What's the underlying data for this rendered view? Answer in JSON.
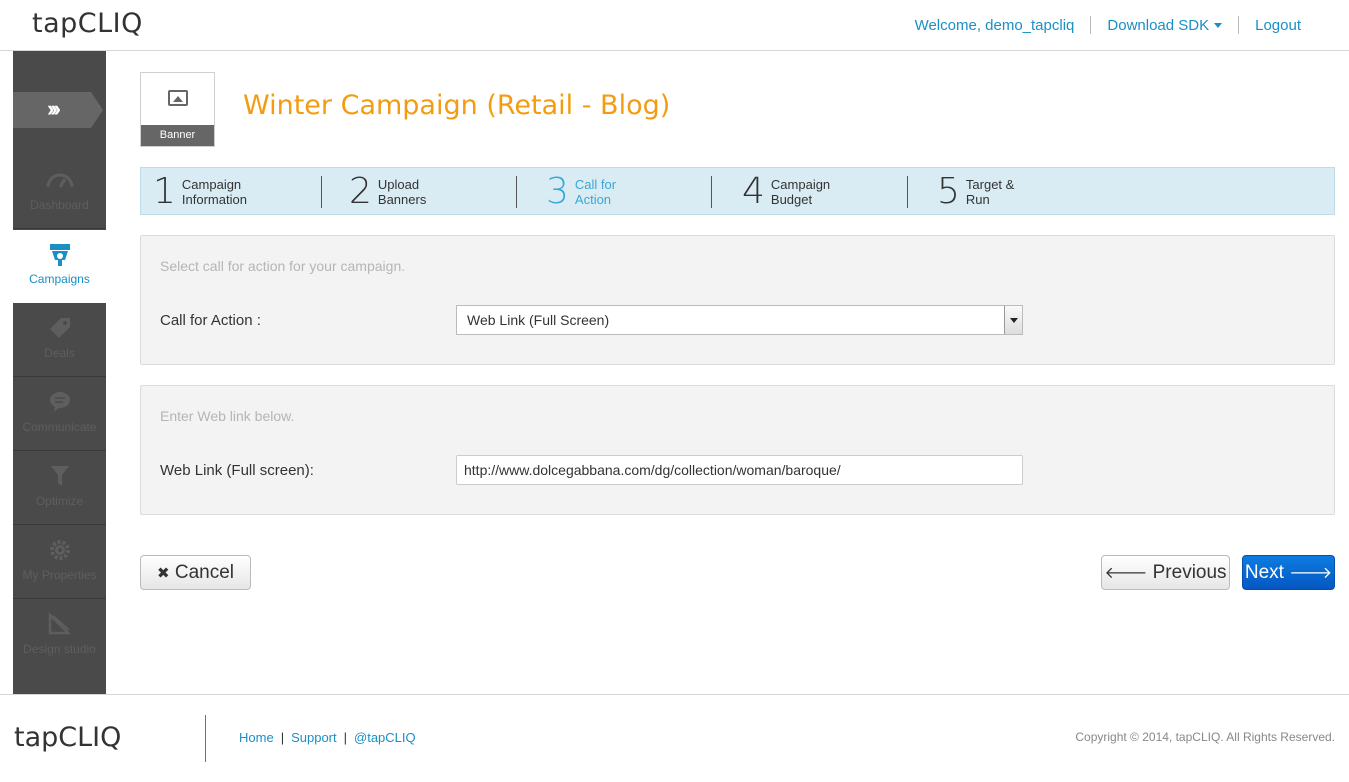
{
  "header": {
    "logo": "tapCLIQ",
    "welcome": "Welcome, demo_tapcliq",
    "download_sdk": "Download SDK",
    "logout": "Logout"
  },
  "sidebar": {
    "toggle_icon": "chevrons-right-icon",
    "items": [
      {
        "label": "Dashboard",
        "icon": "gauge-icon"
      },
      {
        "label": "Campaigns",
        "icon": "campaign-icon"
      },
      {
        "label": "Deals",
        "icon": "tag-icon"
      },
      {
        "label": "Communicate",
        "icon": "chat-icon"
      },
      {
        "label": "Optimize",
        "icon": "funnel-icon"
      },
      {
        "label": "My Properties",
        "icon": "gear-icon"
      },
      {
        "label": "Design studio",
        "icon": "design-icon"
      }
    ]
  },
  "campaign": {
    "type_label": "Banner",
    "title": "Winter Campaign (Retail - Blog)"
  },
  "steps": [
    {
      "num": "1",
      "line1": "Campaign",
      "line2": "Information"
    },
    {
      "num": "2",
      "line1": "Upload",
      "line2": "Banners"
    },
    {
      "num": "3",
      "line1": "Call for",
      "line2": "Action"
    },
    {
      "num": "4",
      "line1": "Campaign",
      "line2": "Budget"
    },
    {
      "num": "5",
      "line1": "Target &",
      "line2": "Run"
    }
  ],
  "cta_panel": {
    "hint": "Select call for action for your campaign.",
    "label": "Call for Action :",
    "selected": "Web Link (Full Screen)"
  },
  "link_panel": {
    "hint": "Enter Web link below.",
    "label": "Web Link (Full screen):",
    "value": "http://www.dolcegabbana.com/dg/collection/woman/baroque/"
  },
  "buttons": {
    "cancel": "Cancel",
    "previous": "Previous",
    "next": "Next"
  },
  "footer": {
    "logo": "tapCLIQ",
    "home": "Home",
    "support": "Support",
    "twitter": "@tapCLIQ",
    "copyright": "Copyright © 2014, tapCLIQ. All Rights Reserved."
  },
  "colors": {
    "accent": "#1a8fc6",
    "title": "#f39c12",
    "primary_button": "#0a6ad6",
    "sidebar": "#4a4a4a"
  }
}
